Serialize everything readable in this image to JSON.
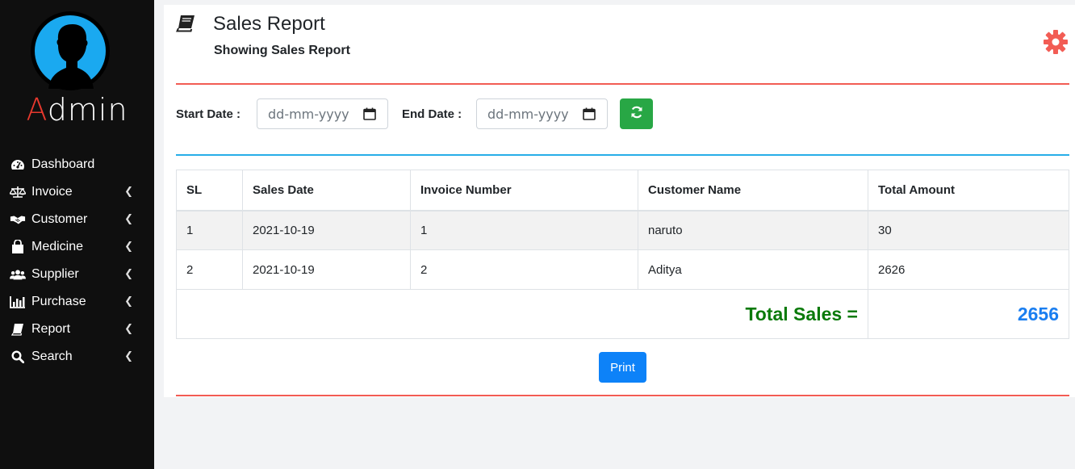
{
  "sidebar": {
    "brand_first": "A",
    "brand_rest": "dmin",
    "items": [
      {
        "label": "Dashboard",
        "icon": "tachometer-icon",
        "has_submenu": false
      },
      {
        "label": "Invoice",
        "icon": "balance-scale-icon",
        "has_submenu": true
      },
      {
        "label": "Customer",
        "icon": "handshake-icon",
        "has_submenu": true
      },
      {
        "label": "Medicine",
        "icon": "shopping-bag-icon",
        "has_submenu": true
      },
      {
        "label": "Supplier",
        "icon": "users-icon",
        "has_submenu": true
      },
      {
        "label": "Purchase",
        "icon": "bar-chart-icon",
        "has_submenu": true
      },
      {
        "label": "Report",
        "icon": "book-icon",
        "has_submenu": true
      },
      {
        "label": "Search",
        "icon": "search-icon",
        "has_submenu": true
      }
    ]
  },
  "header": {
    "title": "Sales Report",
    "subtitle": "Showing Sales Report"
  },
  "filters": {
    "start_label": "Start Date :",
    "start_placeholder": "dd-mm-yyyy",
    "end_label": "End Date :",
    "end_placeholder": "dd-mm-yyyy"
  },
  "table": {
    "columns": [
      "SL",
      "Sales Date",
      "Invoice Number",
      "Customer Name",
      "Total Amount"
    ],
    "rows": [
      [
        "1",
        "2021-10-19",
        "1",
        "naruto",
        "30"
      ],
      [
        "2",
        "2021-10-19",
        "2",
        "Aditya",
        "2626"
      ]
    ],
    "total_label": "Total Sales =",
    "total_value": "2656"
  },
  "print_label": "Print",
  "colors": {
    "sidebar_bg": "#0f0f0f",
    "accent_red": "#f25c54",
    "accent_blue": "#27aee8",
    "success_green": "#28a745",
    "primary_blue": "#0d82f8",
    "total_green": "#0a7a0a"
  }
}
